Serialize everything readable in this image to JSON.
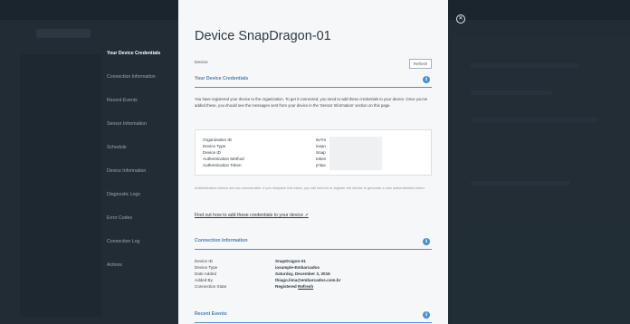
{
  "nav": {
    "items": [
      {
        "label": "Your Device Credentials",
        "active": true
      },
      {
        "label": "Connection Information",
        "active": false
      },
      {
        "label": "Recent Events",
        "active": false
      },
      {
        "label": "Sensor Information",
        "active": false
      },
      {
        "label": "Schedule",
        "active": false
      },
      {
        "label": "Device Information",
        "active": false
      },
      {
        "label": "Diagnostic Logs",
        "active": false
      },
      {
        "label": "Error Codes",
        "active": false
      },
      {
        "label": "Connection Log",
        "active": false
      },
      {
        "label": "Actions",
        "active": false
      }
    ]
  },
  "modal": {
    "title": "Device SnapDragon-01",
    "device_label": "Device",
    "refresh_label": "Refresh",
    "credentials": {
      "title": "Your Device Credentials",
      "description": "You have registered your device to the organization. To get it connected, you need to add these credentials to your device. Once you've added these, you should see the messages sent from your device in the 'Sensor Information' section on this page.",
      "rows": [
        {
          "label": "Organization ID",
          "value": "6v7m"
        },
        {
          "label": "Device Type",
          "value": "iosan"
        },
        {
          "label": "Device ID",
          "value": "Snap"
        },
        {
          "label": "Authentication Method",
          "value": "token"
        },
        {
          "label": "Authentication Token",
          "value": "p*&w"
        }
      ],
      "note": "Authentication tokens are non-recoverable. If you misplace this token, you will need to re-register the device to generate a new authentication token.",
      "link": "Find out how to add these credentials to your device"
    },
    "connection": {
      "title": "Connection Information",
      "rows": [
        {
          "label": "Device ID",
          "value": "SnapDragon-01"
        },
        {
          "label": "Device Type",
          "value": "iosample-Embarcados"
        },
        {
          "label": "Date Added",
          "value": "Saturday, December 3, 2016"
        },
        {
          "label": "Added By",
          "value": "thiago.lima@embarcados.com.br"
        },
        {
          "label": "Connection State",
          "value": "Registered",
          "action": "Refresh"
        }
      ]
    },
    "events": {
      "title": "Recent Events"
    }
  },
  "icons": {
    "close": "close-icon",
    "info": "info-icon",
    "external_link": "external-link-icon"
  },
  "colors": {
    "accent": "#4a90d9",
    "section_title": "#4a7fb8",
    "modal_bg": "#f6f7f8",
    "backdrop": "#2b3a45"
  }
}
